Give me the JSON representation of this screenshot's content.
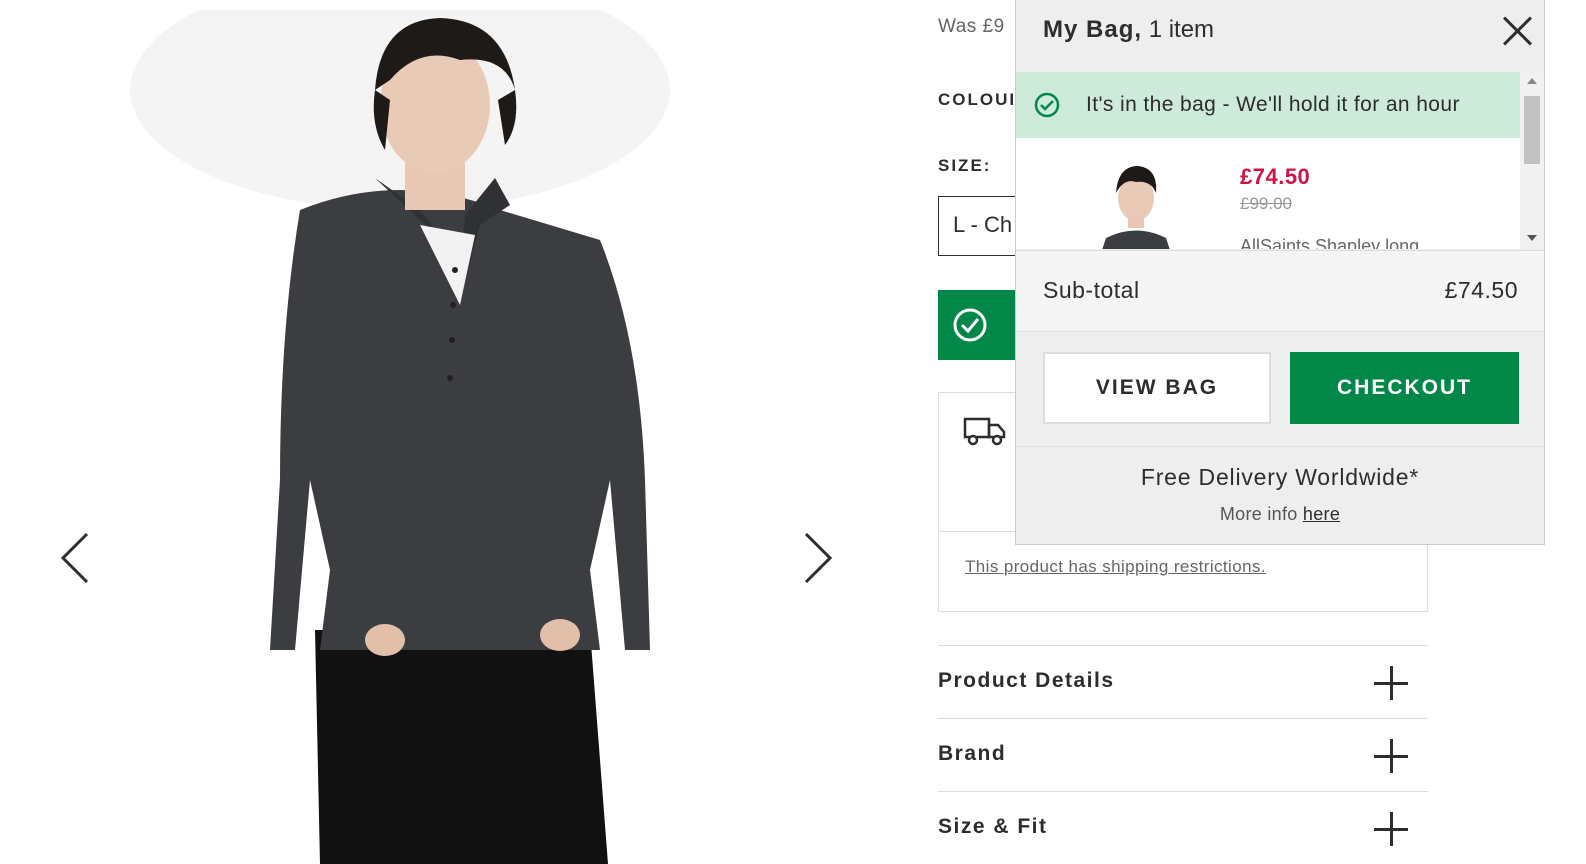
{
  "product": {
    "was_price_partial": "Was £9",
    "colour_label_partial": "COLOUI",
    "size_label": "SIZE:",
    "size_selected_partial": "L - Ch",
    "shipping_restrictions": "This product has shipping restrictions.",
    "accordion": [
      {
        "label": "Product Details"
      },
      {
        "label": "Brand"
      },
      {
        "label": "Size & Fit"
      }
    ]
  },
  "gallery": {
    "prev_icon": "chevron-left-icon",
    "next_icon": "chevron-right-icon"
  },
  "bag": {
    "title": "My Bag,",
    "count": "1 item",
    "held_message": "It's in the bag - We'll hold it for an hour",
    "item": {
      "price": "£74.50",
      "was_price": "£99.00",
      "name_partial": "AllSaints Shapley long"
    },
    "subtotal_label": "Sub-total",
    "subtotal_value": "£74.50",
    "view_bag_label": "VIEW BAG",
    "checkout_label": "CHECKOUT",
    "free_delivery": "Free Delivery Worldwide*",
    "more_info_prefix": "More info ",
    "more_info_link": "here"
  },
  "colors": {
    "accent_green": "#018849",
    "sale_red": "#d01345",
    "held_bg": "#cdeadb"
  }
}
